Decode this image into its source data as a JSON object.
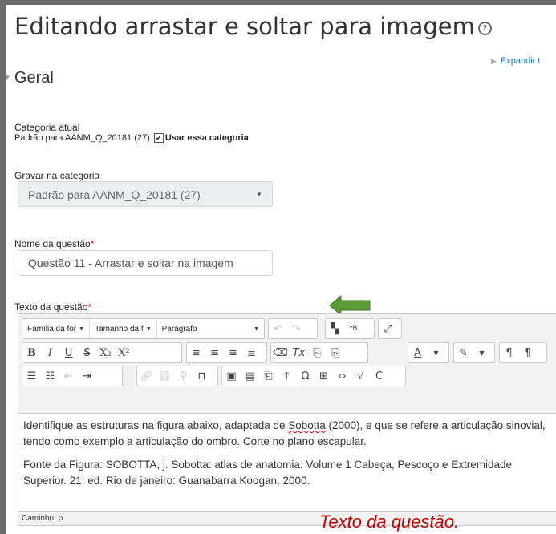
{
  "page": {
    "title": "Editando arrastar e soltar para imagem",
    "expand_all": "Expandir t"
  },
  "section": {
    "title": "Geral"
  },
  "category": {
    "label": "Categoria atual",
    "current_value": "Padrão para AANM_Q_20181 (27)",
    "checkbox_label": "Usar essa categoria",
    "checkbox_checked": true
  },
  "save_category": {
    "label": "Gravar na categoria",
    "selected": "Padrão para AANM_Q_20181 (27)"
  },
  "question_name": {
    "label": "Nome da questão",
    "required_mark": "*",
    "value": "Questão 11 - Arrastar e soltar na imagem"
  },
  "question_text": {
    "label": "Texto da questão",
    "required_mark": "*"
  },
  "editor": {
    "toolbar": {
      "font_family": "Família da for",
      "font_size": "Tamanho da f",
      "paragraph": "Parágrafo"
    },
    "content": {
      "p1_before": "Identifique as estruturas na figura abaixo, adaptada de ",
      "p1_link": "Sobotta",
      "p1_after": " (2000), e que se refere a articulação sinovial, tendo como exemplo a articulação do ombro. Corte no plano escapular.",
      "p2": "Fonte da Figura: SOBOTTA, j. Sobotta: atlas de anatomia. Volume 1 Cabeça, Pescoço e Extremidade Superior. 21. ed. Rio de janeiro: Guanabarra Koogan, 2000."
    },
    "status": "Caminho: p"
  },
  "annotation": {
    "caption": "Texto da questão.",
    "arrow_color": "#5b9b34",
    "caption_color": "#c00000"
  }
}
